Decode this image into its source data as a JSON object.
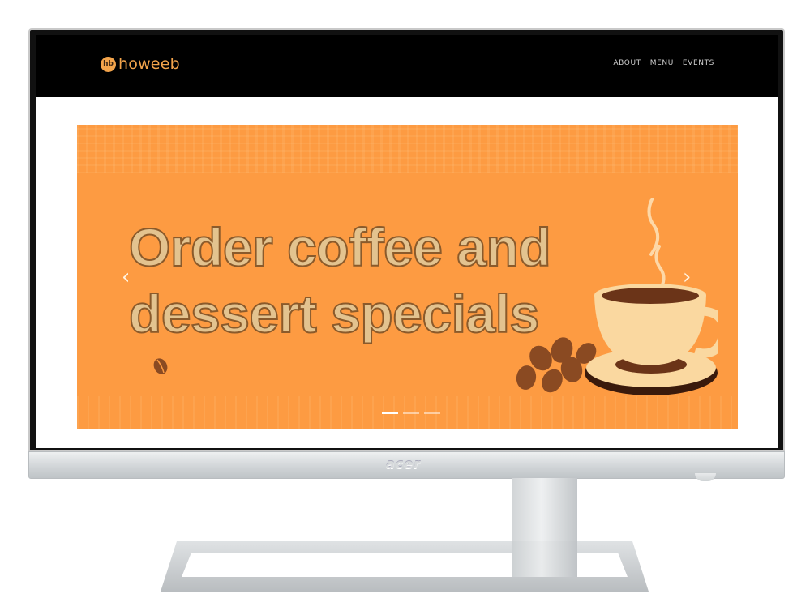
{
  "site": {
    "logo_text": "howeeb",
    "logo_mark": "hb",
    "nav": [
      "ABOUT",
      "MENU",
      "EVENTS"
    ]
  },
  "hero": {
    "headline_line1": "Order coffee and",
    "headline_line2": "dessert specials",
    "prev_arrow": "‹",
    "next_arrow": "›",
    "slides_count": 3,
    "active_slide": 1,
    "background_color": "#fd9b42",
    "text_color": "#e3c38f"
  },
  "device": {
    "brand": "acer"
  },
  "icons": [
    "logo-mark-icon",
    "chevron-left-icon",
    "chevron-right-icon",
    "coffee-cup-icon",
    "coffee-bean-icon"
  ]
}
